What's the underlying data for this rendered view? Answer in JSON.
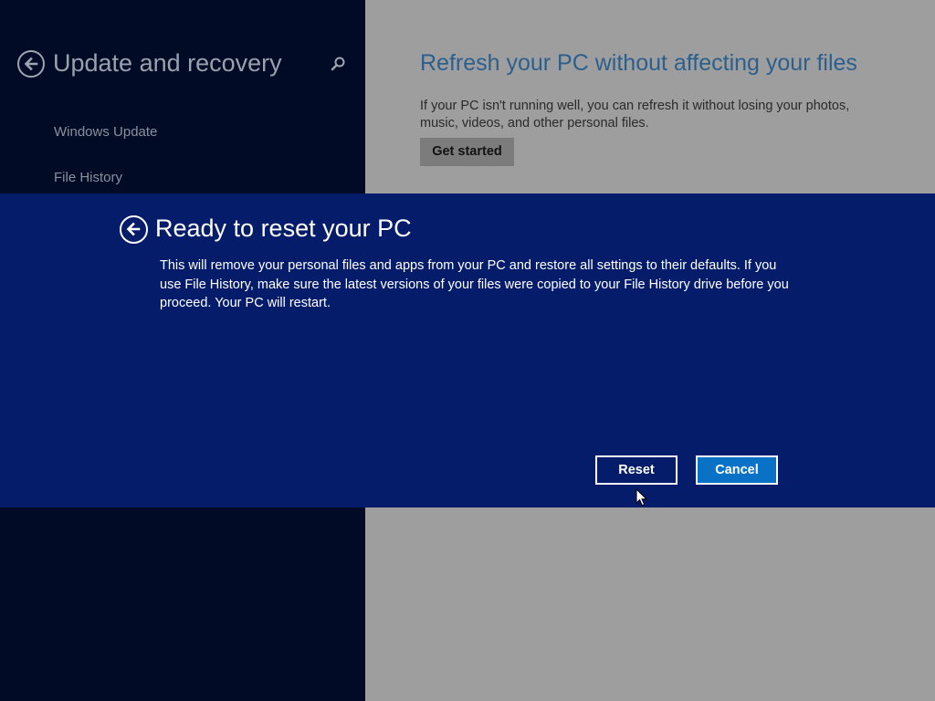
{
  "left_pane": {
    "title": "Update and recovery",
    "nav_items": [
      {
        "label": "Windows Update"
      },
      {
        "label": "File History"
      }
    ],
    "icons": {
      "back": "back-arrow-icon",
      "search": "search-icon"
    }
  },
  "right_pane": {
    "title": "Refresh your PC without affecting your files",
    "description": "If your PC isn't running well, you can refresh it without losing your photos, music, videos, and other personal files.",
    "button_label": "Get started"
  },
  "dialog": {
    "title": "Ready to reset your PC",
    "body": "This will remove your personal files and apps from your PC and restore all settings to their defaults. If you use File History, make sure the latest versions of your files were copied to your File History drive before you proceed. Your PC will restart.",
    "reset_label": "Reset",
    "cancel_label": "Cancel",
    "icons": {
      "back": "back-arrow-icon"
    }
  },
  "colors": {
    "left_bg": "#010b26",
    "right_bg": "#9e9e9e",
    "dialog_bg": "#041c6a",
    "accent": "#0a72c6",
    "title_blue": "#2c5f8c"
  }
}
